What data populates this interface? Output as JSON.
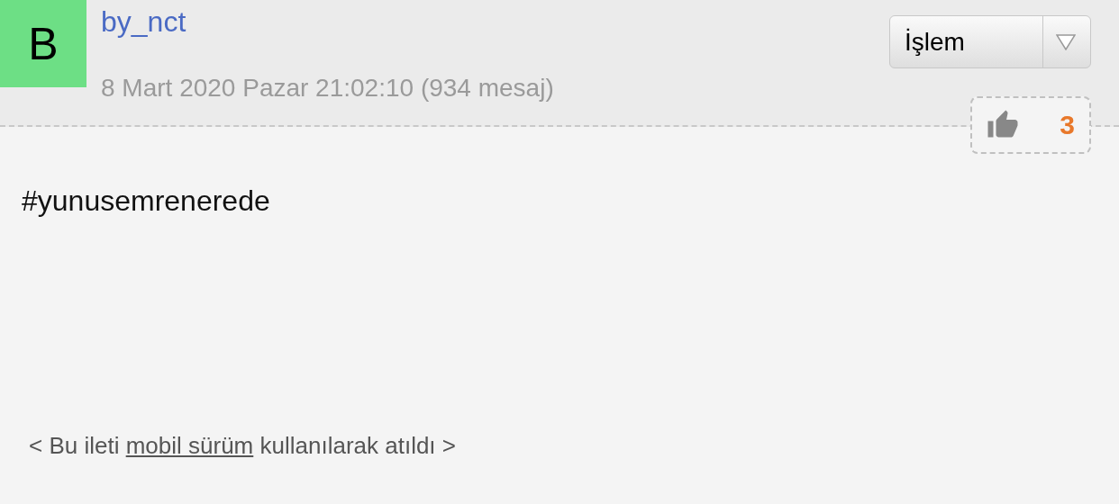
{
  "post": {
    "avatar_letter": "B",
    "author": "by_nct",
    "date": "8 Mart 2020 Pazar 21:02:10 (934 mesaj)",
    "action_menu": {
      "label": "İşlem"
    },
    "likes": {
      "count": "3"
    },
    "body": "#yunusemrenerede",
    "footer": {
      "before": "< Bu ileti ",
      "link": "mobil sürüm",
      "after": " kullanılarak atıldı >"
    }
  }
}
